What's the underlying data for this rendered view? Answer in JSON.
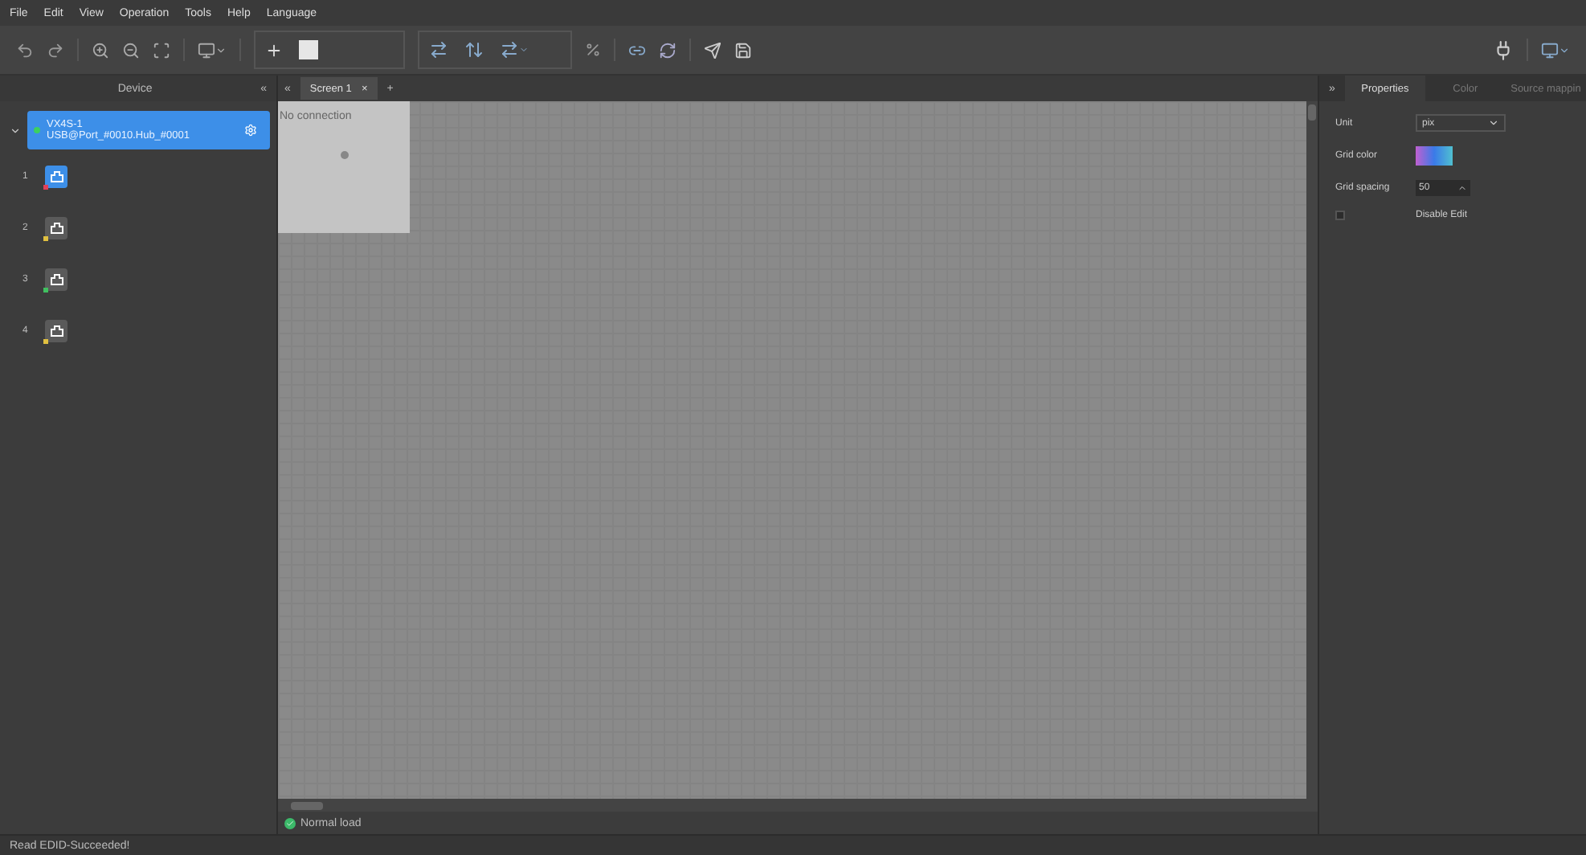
{
  "menu": [
    "File",
    "Edit",
    "View",
    "Operation",
    "Tools",
    "Help",
    "Language"
  ],
  "device_panel": {
    "title": "Device",
    "collapse": "«",
    "device": {
      "name": "VX4S-1",
      "port": "USB@Port_#0010.Hub_#0001",
      "expanded": true,
      "connected": true
    },
    "ports": [
      {
        "number": "1",
        "selected": true,
        "color": "#e0405a"
      },
      {
        "number": "2",
        "selected": false,
        "color": "#e0c040"
      },
      {
        "number": "3",
        "selected": false,
        "color": "#40c060"
      },
      {
        "number": "4",
        "selected": false,
        "color": "#e0c040"
      }
    ]
  },
  "screen_tabs": {
    "collapse": "«",
    "tabs": [
      {
        "label": "Screen 1",
        "close": "×",
        "selected": true
      }
    ],
    "add": "+"
  },
  "canvas": {
    "cabinet": {
      "label": "No connection"
    },
    "status": "Normal load"
  },
  "properties_panel": {
    "collapse": "»",
    "tabs": [
      {
        "label": "Properties",
        "selected": true
      },
      {
        "label": "Color",
        "selected": false
      },
      {
        "label": "Source mappin",
        "selected": false
      }
    ],
    "unit": {
      "label": "Unit",
      "value": "pix"
    },
    "grid_color": {
      "label": "Grid color"
    },
    "grid_spacing": {
      "label": "Grid spacing",
      "value": "50"
    },
    "disable_edit": {
      "label": "Disable Edit",
      "checked": false
    }
  },
  "status_bar": "Read EDID-Succeeded!"
}
